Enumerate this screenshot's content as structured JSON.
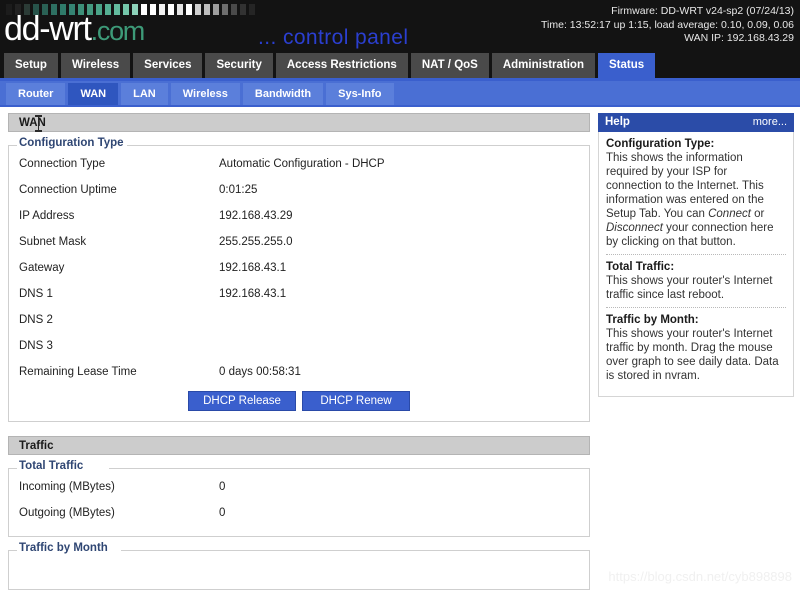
{
  "brand": {
    "logo_main": "dd-wrt",
    "logo_suffix": ".com",
    "tagline": "... control panel",
    "segment_colors": [
      "#1c1c1c",
      "#222222",
      "#2b3b36",
      "#27534a",
      "#2a6155",
      "#2e7062",
      "#2f7b6a",
      "#358473",
      "#3d9079",
      "#449a80",
      "#4aa488",
      "#55b093",
      "#63bb9e",
      "#74c6aa",
      "#8dd2ba",
      "#ffffff",
      "#ffffff",
      "#f2f2f2",
      "#ffffff",
      "#e4e4e4",
      "#ffffff",
      "#d0d0d0",
      "#bdbdbd",
      "#9e9e9e",
      "#6e6e6e",
      "#4a4a4a",
      "#323232",
      "#252525"
    ]
  },
  "status": {
    "firmware": "Firmware: DD-WRT v24-sp2 (07/24/13)",
    "time": "Time: 13:52:17 up 1:15, load average: 0.10, 0.09, 0.06",
    "wan_ip": "WAN IP: 192.168.43.29"
  },
  "main_tabs": [
    {
      "label": "Setup",
      "active": false
    },
    {
      "label": "Wireless",
      "active": false
    },
    {
      "label": "Services",
      "active": false
    },
    {
      "label": "Security",
      "active": false
    },
    {
      "label": "Access Restrictions",
      "active": false
    },
    {
      "label": "NAT / QoS",
      "active": false
    },
    {
      "label": "Administration",
      "active": false
    },
    {
      "label": "Status",
      "active": true
    }
  ],
  "sub_tabs": [
    {
      "label": "Router",
      "active": false
    },
    {
      "label": "WAN",
      "active": true
    },
    {
      "label": "LAN",
      "active": false
    },
    {
      "label": "Wireless",
      "active": false
    },
    {
      "label": "Bandwidth",
      "active": false
    },
    {
      "label": "Sys-Info",
      "active": false
    }
  ],
  "page": {
    "title": "WAN",
    "traffic_band_title": "Traffic"
  },
  "config_section": {
    "legend": "Configuration Type",
    "rows": [
      {
        "label": "Connection Type",
        "value": "Automatic Configuration - DHCP"
      },
      {
        "label": "Connection Uptime",
        "value": "0:01:25"
      },
      {
        "label": "IP Address",
        "value": "192.168.43.29"
      },
      {
        "label": "Subnet Mask",
        "value": "255.255.255.0"
      },
      {
        "label": "Gateway",
        "value": "192.168.43.1"
      },
      {
        "label": "DNS 1",
        "value": "192.168.43.1"
      },
      {
        "label": "DNS 2",
        "value": ""
      },
      {
        "label": "DNS 3",
        "value": ""
      },
      {
        "label": "Remaining Lease Time",
        "value": "0 days 00:58:31"
      }
    ],
    "buttons": [
      {
        "label": "DHCP Release"
      },
      {
        "label": "DHCP Renew"
      }
    ]
  },
  "total_traffic": {
    "legend": "Total Traffic",
    "rows": [
      {
        "label": "Incoming (MBytes)",
        "value": "0"
      },
      {
        "label": "Outgoing (MBytes)",
        "value": "0"
      }
    ]
  },
  "traffic_by_month": {
    "legend": "Traffic by Month"
  },
  "help": {
    "title": "Help",
    "more_label": "more...",
    "sections": [
      {
        "heading": "Configuration Type:",
        "body_pre": "This shows the information required by your ISP for connection to the Internet. This information was entered on the Setup Tab. You can ",
        "em1": "Connect",
        "body_mid": " or ",
        "em2": "Disconnect",
        "body_post": " your connection here by clicking on that button."
      },
      {
        "heading": "Total Traffic:",
        "body_pre": "This shows your router's Internet traffic since last reboot.",
        "em1": "",
        "body_mid": "",
        "em2": "",
        "body_post": ""
      },
      {
        "heading": "Traffic by Month:",
        "body_pre": "This shows your router's Internet traffic by month. Drag the mouse over graph to see daily data. Data is stored in nvram.",
        "em1": "",
        "body_mid": "",
        "em2": "",
        "body_post": ""
      }
    ]
  },
  "watermark": "https://blog.csdn.net/cyb898898"
}
